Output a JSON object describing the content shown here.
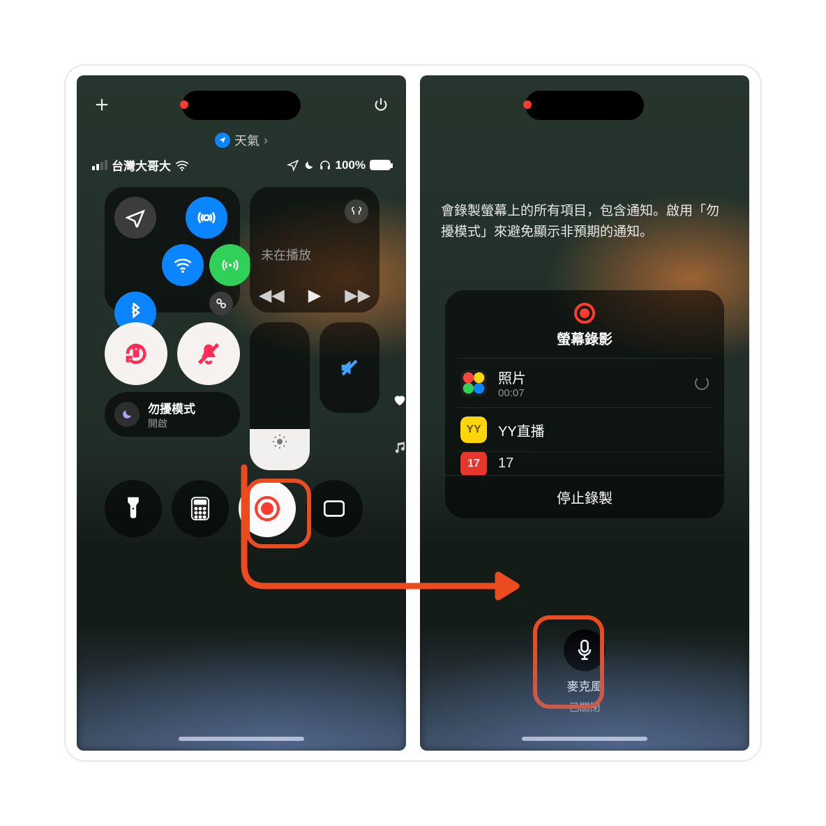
{
  "left": {
    "breadcrumb": {
      "app": "天氣"
    },
    "status": {
      "carrier": "台灣大哥大",
      "battery_pct": "100%"
    },
    "media": {
      "title": "未在播放"
    },
    "focus": {
      "title": "勿擾模式",
      "state": "開啟"
    }
  },
  "right": {
    "message": "會錄製螢幕上的所有項目，包含通知。啟用「勿擾模式」來避免顯示非預期的通知。",
    "card": {
      "title": "螢幕錄影",
      "items": [
        {
          "name": "照片",
          "sub": "00:07"
        },
        {
          "name": "YY直播"
        },
        {
          "name": "17"
        }
      ],
      "stop": "停止錄製"
    },
    "mic": {
      "label": "麥克風",
      "state": "已關閉"
    }
  }
}
